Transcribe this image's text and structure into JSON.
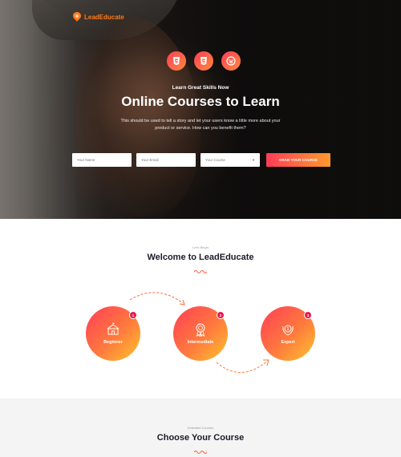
{
  "brand": {
    "name": "LeadEducate",
    "color": "#ff7a1a"
  },
  "hero": {
    "tech_icons": [
      "html5-icon",
      "css3-icon",
      "wordpress-icon"
    ],
    "kicker": "Learn Great Skills Now",
    "title": "Online Courses to Learn",
    "description": "This should be used to tell a story and let your users know a little more about your product or service. How can you benefit them?",
    "form": {
      "name_placeholder": "Your Name",
      "email_placeholder": "Your Email",
      "course_select": "Your Course",
      "submit_label": "GRAB YOUR COURSE"
    }
  },
  "welcome": {
    "kicker": "Let's Begin",
    "title": "Welcome to LeadEducate",
    "steps": [
      {
        "number": "1",
        "label": "Beginner",
        "icon": "school-icon"
      },
      {
        "number": "2",
        "label": "Intermediate",
        "icon": "award-ribbon-icon"
      },
      {
        "number": "3",
        "label": "Expert",
        "icon": "laurel-medal-icon"
      }
    ]
  },
  "courses": {
    "kicker": "Unlimited Courses",
    "title": "Choose Your Course"
  },
  "colors": {
    "gradient_start": "#ff3d57",
    "gradient_end": "#ffc42e",
    "badge": "#e8194f",
    "title": "#1b1b2b"
  }
}
